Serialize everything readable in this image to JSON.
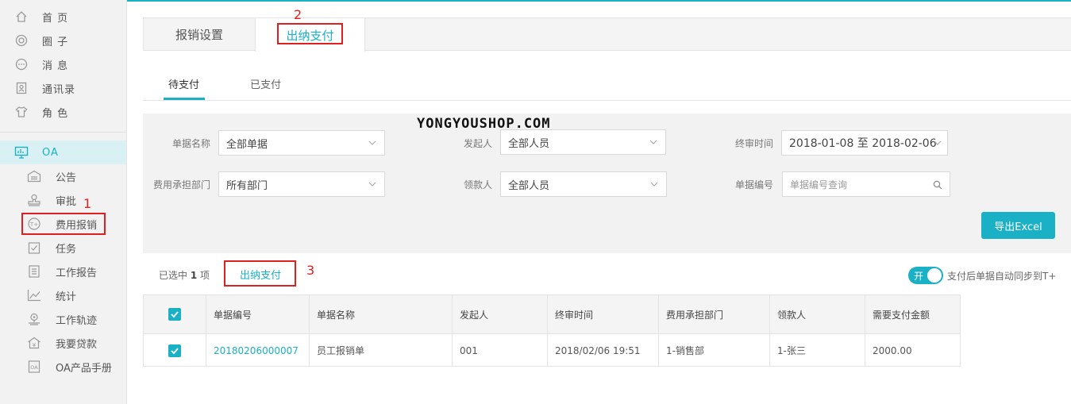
{
  "sidebar": {
    "top_items": [
      {
        "label": "首 页",
        "icon": "home-icon"
      },
      {
        "label": "圈 子",
        "icon": "circle-icon"
      },
      {
        "label": "消 息",
        "icon": "message-icon"
      },
      {
        "label": "通讯录",
        "icon": "contacts-icon"
      },
      {
        "label": "角 色",
        "icon": "shirt-icon"
      }
    ],
    "oa": {
      "label": "OA",
      "icon": "monitor-icon"
    },
    "sub_items": [
      {
        "label": "公告",
        "icon": "notice-icon"
      },
      {
        "label": "审批",
        "icon": "stamp-icon"
      },
      {
        "label": "费用报销",
        "icon": "reimburse-icon"
      },
      {
        "label": "任务",
        "icon": "task-icon"
      },
      {
        "label": "工作报告",
        "icon": "report-icon"
      },
      {
        "label": "统计",
        "icon": "chart-icon"
      },
      {
        "label": "工作轨迹",
        "icon": "location-icon"
      },
      {
        "label": "我要贷款",
        "icon": "loan-icon"
      },
      {
        "label": "OA产品手册",
        "icon": "manual-icon"
      }
    ]
  },
  "annotations": {
    "n1": "1",
    "n2": "2",
    "n3": "3"
  },
  "tabs": {
    "settings": "报销设置",
    "cashier": "出纳支付"
  },
  "subtabs": {
    "pending": "待支付",
    "paid": "已支付"
  },
  "filters": {
    "doc_name_label": "单据名称",
    "doc_name_value": "全部单据",
    "initiator_label": "发起人",
    "initiator_value": "全部人员",
    "final_time_label": "终审时间",
    "final_time_value": "2018-01-08 至 2018-02-06",
    "dept_label": "费用承担部门",
    "dept_value": "所有部门",
    "payee_label": "领款人",
    "payee_value": "全部人员",
    "doc_no_label": "单据编号",
    "doc_no_placeholder": "单据编号查询",
    "export_label": "导出Excel"
  },
  "watermark": "YONGYOUSHOP.COM",
  "actions": {
    "selected_prefix": "已选中 ",
    "selected_count": "1",
    "selected_suffix": " 项",
    "pay_label": "出纳支付",
    "toggle_text": "开",
    "toggle_label": "支付后单据自动同步到T+"
  },
  "table": {
    "headers": [
      "单据编号",
      "单据名称",
      "发起人",
      "终审时间",
      "费用承担部门",
      "领款人",
      "需要支付金额"
    ],
    "rows": [
      [
        "20180206000007",
        "员工报销单",
        "001",
        "2018/02/06 19:51",
        "1-销售部",
        "1-张三",
        "2000.00"
      ]
    ]
  },
  "colors": {
    "accent": "#1ab0c6",
    "annotation": "#e02020"
  }
}
